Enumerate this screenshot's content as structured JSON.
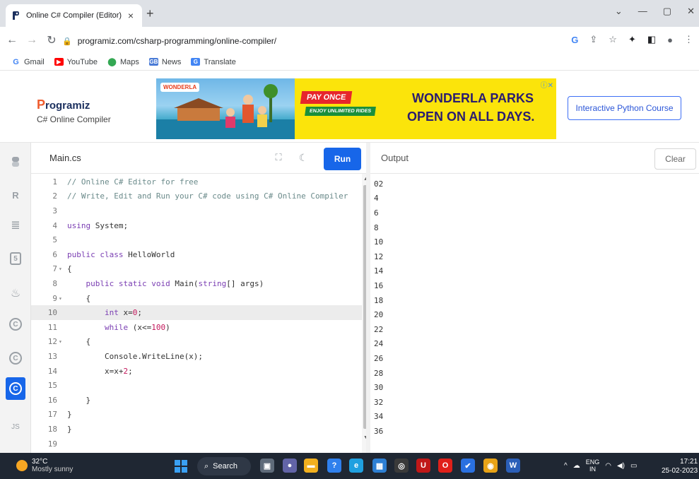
{
  "browser": {
    "tab_title": "Online C# Compiler (Editor)",
    "tab_close": "×",
    "new_tab": "+",
    "url": "programiz.com/csharp-programming/online-compiler/",
    "bookmarks": [
      {
        "label": "Gmail",
        "icon_text": "G",
        "color": "#4285f4"
      },
      {
        "label": "YouTube",
        "icon_text": "▶",
        "color": "#ff0000"
      },
      {
        "label": "Maps",
        "icon_text": "",
        "color": "#34a853"
      },
      {
        "label": "News",
        "icon_text": "GB",
        "color": "#4a7bd6"
      },
      {
        "label": "Translate",
        "icon_text": "G",
        "color": "#4285f4"
      }
    ],
    "window_controls": [
      "⌄",
      "—",
      "▢",
      "✕"
    ]
  },
  "site": {
    "logo": "rogramiz",
    "logo_p": "P",
    "subtitle": "C# Online Compiler",
    "ad": {
      "brand": "WONDERLA",
      "pay_once": "PAY ONCE",
      "rides": "ENJOY UNLIMITED RIDES",
      "line1": "WONDERLA PARKS",
      "line2": "OPEN ON ALL DAYS.",
      "close": "ⓘ✕"
    },
    "course_button": "Interactive Python Course"
  },
  "languages": [
    {
      "name": "python-icon",
      "glyph": "🐍"
    },
    {
      "name": "r-icon",
      "glyph": "R"
    },
    {
      "name": "sql-icon",
      "glyph": "≣"
    },
    {
      "name": "html-icon",
      "glyph": "5"
    },
    {
      "name": "java-icon",
      "glyph": "♨"
    },
    {
      "name": "c-icon",
      "glyph": "C"
    },
    {
      "name": "cpp-icon",
      "glyph": "C"
    },
    {
      "name": "csharp-icon",
      "glyph": "C",
      "active": true
    },
    {
      "name": "js-icon",
      "glyph": "JS"
    }
  ],
  "editor": {
    "filename": "Main.cs",
    "run_label": "Run",
    "fullscreen_icon": "⛶",
    "theme_icon": "☾",
    "highlighted_line": 10,
    "lines": [
      {
        "n": "1",
        "fold": "",
        "html": "<span class=\"cm\">// Online C# Editor for free</span>"
      },
      {
        "n": "2",
        "fold": "",
        "html": "<span class=\"cm\">// Write, Edit and Run your C# code using C# Online Compiler</span>"
      },
      {
        "n": "3",
        "fold": "",
        "html": ""
      },
      {
        "n": "4",
        "fold": "",
        "html": "<span class=\"kw\">using</span> System;"
      },
      {
        "n": "5",
        "fold": "",
        "html": ""
      },
      {
        "n": "6",
        "fold": "",
        "html": "<span class=\"kw\">public</span> <span class=\"kw\">class</span> HelloWorld"
      },
      {
        "n": "7",
        "fold": "▾",
        "html": "{"
      },
      {
        "n": "8",
        "fold": "",
        "html": "    <span class=\"kw\">public</span> <span class=\"kw\">static</span> <span class=\"kw\">void</span> Main(<span class=\"kw\">string</span>[] args)"
      },
      {
        "n": "9",
        "fold": "▾",
        "html": "    {"
      },
      {
        "n": "10",
        "fold": "",
        "html": "        <span class=\"kw\">int</span> x=<span class=\"num\">0</span>;"
      },
      {
        "n": "11",
        "fold": "",
        "html": "        <span class=\"kw\">while</span> (x&lt;=<span class=\"num\">100</span>)"
      },
      {
        "n": "12",
        "fold": "▾",
        "html": "    {"
      },
      {
        "n": "13",
        "fold": "",
        "html": "        Console.WriteLine(x);"
      },
      {
        "n": "14",
        "fold": "",
        "html": "        x=x+<span class=\"num\">2</span>;"
      },
      {
        "n": "15",
        "fold": "",
        "html": ""
      },
      {
        "n": "16",
        "fold": "",
        "html": "    }"
      },
      {
        "n": "17",
        "fold": "",
        "html": "}"
      },
      {
        "n": "18",
        "fold": "",
        "html": "}"
      },
      {
        "n": "19",
        "fold": "",
        "html": ""
      }
    ]
  },
  "output": {
    "label": "Output",
    "clear_label": "Clear",
    "lines": [
      "02",
      "4",
      "6",
      "8",
      "10",
      "12",
      "14",
      "16",
      "18",
      "20",
      "22",
      "24",
      "26",
      "28",
      "30",
      "32",
      "34",
      "36"
    ]
  },
  "taskbar": {
    "temp": "32°C",
    "weather": "Mostly sunny",
    "search": "Search",
    "lang_top": "ENG",
    "lang_bottom": "IN",
    "time": "17:21",
    "date": "25-02-2023",
    "apps": [
      {
        "name": "task-view-icon",
        "color": "#5f6b7a",
        "glyph": "▣"
      },
      {
        "name": "chat-icon",
        "color": "#6264a7",
        "glyph": "●"
      },
      {
        "name": "file-explorer-icon",
        "color": "#f2b01e",
        "glyph": "▬"
      },
      {
        "name": "help-icon",
        "color": "#2f80ed",
        "glyph": "?"
      },
      {
        "name": "edge-icon",
        "color": "#1fa0e0",
        "glyph": "e"
      },
      {
        "name": "store-icon",
        "color": "#2d7fd3",
        "glyph": "▦"
      },
      {
        "name": "chatgpt-icon",
        "color": "#3a3a3a",
        "glyph": "◎"
      },
      {
        "name": "mcafee-icon",
        "color": "#c01818",
        "glyph": "U"
      },
      {
        "name": "opera-icon",
        "color": "#e0201a",
        "glyph": "O"
      },
      {
        "name": "todo-icon",
        "color": "#2a70e0",
        "glyph": "✔"
      },
      {
        "name": "chrome-icon",
        "color": "#e8a317",
        "glyph": "◉"
      },
      {
        "name": "word-icon",
        "color": "#2b5fb8",
        "glyph": "W"
      }
    ]
  }
}
